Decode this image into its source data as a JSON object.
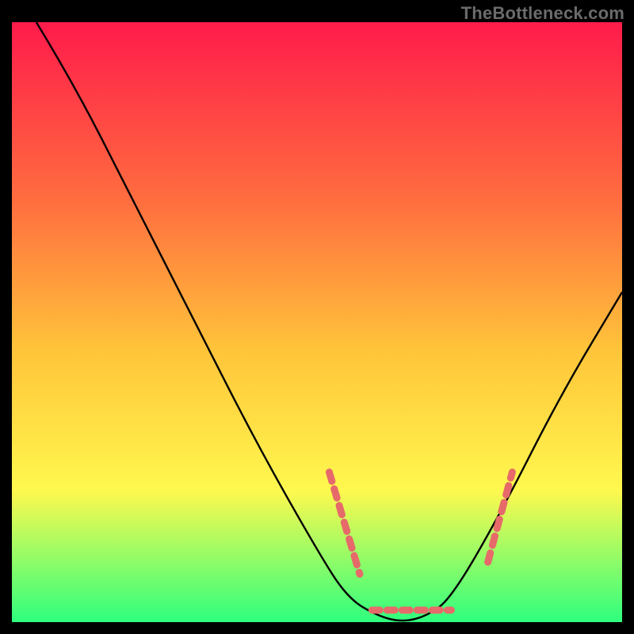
{
  "watermark": "TheBottleneck.com",
  "chart_data": {
    "type": "line",
    "title": "",
    "xlabel": "",
    "ylabel": "",
    "xlim": [
      0,
      100
    ],
    "ylim": [
      0,
      100
    ],
    "background_gradient": {
      "top": "#ff1b4b",
      "mid1": "#ff6e3f",
      "mid2": "#ffc53a",
      "mid3": "#fff84e",
      "bottom": "#2eff7e"
    },
    "series": [
      {
        "name": "bottleneck-curve",
        "color": "#000000",
        "points": [
          {
            "x": 4,
            "y": 100
          },
          {
            "x": 10,
            "y": 90
          },
          {
            "x": 20,
            "y": 70
          },
          {
            "x": 30,
            "y": 50
          },
          {
            "x": 40,
            "y": 30
          },
          {
            "x": 50,
            "y": 12
          },
          {
            "x": 55,
            "y": 4
          },
          {
            "x": 60,
            "y": 1
          },
          {
            "x": 64,
            "y": 0
          },
          {
            "x": 68,
            "y": 1
          },
          {
            "x": 72,
            "y": 4
          },
          {
            "x": 80,
            "y": 18
          },
          {
            "x": 90,
            "y": 38
          },
          {
            "x": 100,
            "y": 55
          }
        ]
      },
      {
        "name": "highlight-left-slope",
        "color": "#e76a6a",
        "style": "dashed",
        "points": [
          {
            "x": 52,
            "y": 25
          },
          {
            "x": 57,
            "y": 8
          }
        ]
      },
      {
        "name": "highlight-right-slope",
        "color": "#e76a6a",
        "style": "dashed",
        "points": [
          {
            "x": 78,
            "y": 10
          },
          {
            "x": 82,
            "y": 25
          }
        ]
      },
      {
        "name": "highlight-trough",
        "color": "#e76a6a",
        "style": "dashed",
        "points": [
          {
            "x": 59,
            "y": 2
          },
          {
            "x": 72,
            "y": 2
          }
        ]
      }
    ]
  }
}
